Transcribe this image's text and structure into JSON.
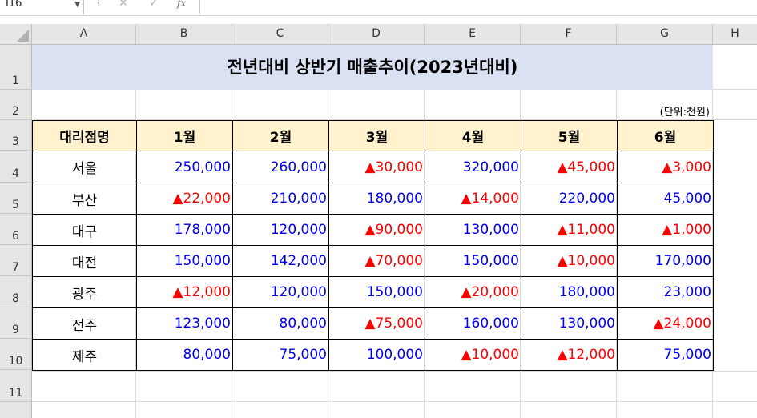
{
  "formula_bar": {
    "name_box": "I16",
    "dropdown_icon": "chevron-down-icon",
    "separator": "⋮",
    "cancel_glyph": "✕",
    "enter_glyph": "✓",
    "fx_label": "fx",
    "formula": ""
  },
  "columns": [
    "A",
    "B",
    "C",
    "D",
    "E",
    "F",
    "G",
    "H"
  ],
  "rows": [
    "1",
    "2",
    "3",
    "4",
    "5",
    "6",
    "7",
    "8",
    "9",
    "10",
    "11"
  ],
  "sheet": {
    "title": "전년대비 상반기 매출추이(2023년대비)",
    "unit": "(단위:천원)",
    "headers": [
      "대리점명",
      "1월",
      "2월",
      "3월",
      "4월",
      "5월",
      "6월"
    ],
    "data": [
      {
        "name": "서울",
        "values": [
          "250,000",
          "260,000",
          "▲30,000",
          "320,000",
          "▲45,000",
          "▲3,000"
        ]
      },
      {
        "name": "부산",
        "values": [
          "▲22,000",
          "210,000",
          "180,000",
          "▲14,000",
          "220,000",
          "45,000"
        ]
      },
      {
        "name": "대구",
        "values": [
          "178,000",
          "120,000",
          "▲90,000",
          "130,000",
          "▲11,000",
          "▲1,000"
        ]
      },
      {
        "name": "대전",
        "values": [
          "150,000",
          "142,000",
          "▲70,000",
          "150,000",
          "▲10,000",
          "170,000"
        ]
      },
      {
        "name": "광주",
        "values": [
          "▲12,000",
          "120,000",
          "150,000",
          "▲20,000",
          "180,000",
          "23,000"
        ]
      },
      {
        "name": "전주",
        "values": [
          "123,000",
          "80,000",
          "▲75,000",
          "160,000",
          "130,000",
          "▲24,000"
        ]
      },
      {
        "name": "제주",
        "values": [
          "80,000",
          "75,000",
          "100,000",
          "▲10,000",
          "▲12,000",
          "75,000"
        ]
      }
    ]
  },
  "colors": {
    "title_fill": "#d9e1f2",
    "header_fill": "#fff2cc",
    "positive_text": "#0000ee",
    "negative_text": "#ff0000"
  }
}
